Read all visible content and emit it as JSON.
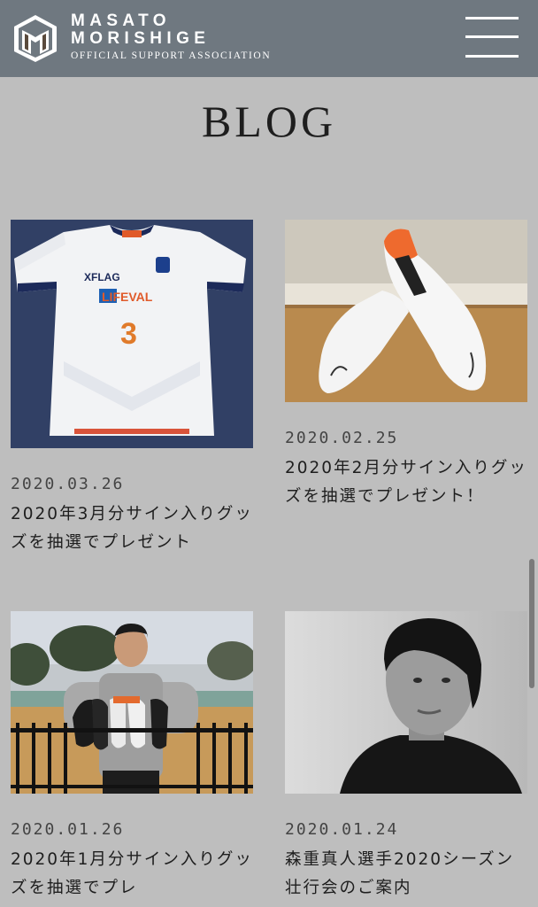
{
  "header": {
    "brand_line1": "MASATO",
    "brand_line2": "MORISHIGE",
    "brand_line3": "OFFICIAL SUPPORT ASSOCIATION",
    "menu_icon": "hamburger-menu-icon"
  },
  "page": {
    "title": "BLOG"
  },
  "posts": [
    {
      "date": "2020.03.26",
      "title": "2020年3月分サイン入りグッズを抽選でプレゼント",
      "image": "signed-jersey-photo"
    },
    {
      "date": "2020.02.25",
      "title": "2020年2月分サイン入りグッズを抽選でプレゼント！",
      "image": "signed-boots-photo"
    },
    {
      "date": "2020.01.26",
      "title": "2020年1月分サイン入りグッズを抽選でプレ",
      "image": "player-holding-boots-photo"
    },
    {
      "date": "2020.01.24",
      "title": "森重真人選手2020シーズン壮行会のご案内",
      "image": "player-portrait-photo"
    }
  ],
  "colors": {
    "header_bg": "#6f7880",
    "page_bg": "#bebebe",
    "text": "#1e1e1e"
  }
}
